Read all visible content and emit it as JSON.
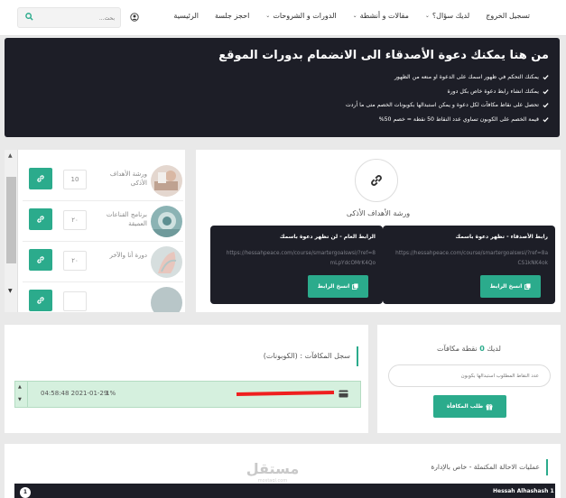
{
  "nav": {
    "search_placeholder": "بحث...",
    "items": [
      {
        "label": "الرئيسية",
        "caret": false
      },
      {
        "label": "احجز جلسة",
        "caret": false
      },
      {
        "label": "الدورات و الشروحات",
        "caret": true
      },
      {
        "label": "مقالات و أنشطة",
        "caret": true
      },
      {
        "label": "لديك سؤال؟",
        "caret": true
      },
      {
        "label": "تسجيل الخروج",
        "caret": false
      }
    ]
  },
  "hero": {
    "title": "من هنا يمكنك دعوة الأصدقاء الى الانضمام بدورات الموقع",
    "bullets": [
      "يمكنك التحكم في ظهور اسمك على الدعوة او منعه من الظهور",
      "يمكنك انشاء رابط دعوة خاص بكل دورة",
      "تحصل على نقاط مكافآت لكل دعوة و يمكن استبدالها بكوبونات الخصم متى ما أردت",
      "قيمة الخصم على الكوبون تساوي عدد النقاط 50 نقطة = خصم 50%"
    ]
  },
  "courses": [
    {
      "title": "ورشة الأهداف الأذكى",
      "points": "10"
    },
    {
      "title": "برنامج القناعات العميقة",
      "points": "٢٠"
    },
    {
      "title": "دورة أنا والآخر",
      "points": "٢٠"
    },
    {
      "title": "",
      "points": ""
    }
  ],
  "invite": {
    "course_title": "ورشة الأهداف الأذكى",
    "cards": [
      {
        "title": "رابط الأصدقاء - تظهر دعوة باسمك",
        "url": "https://hessahpeace.com/course/smartergoalswsi/?ref=8aCS1kNK4ok",
        "button": "انسخ الرابط"
      },
      {
        "title": "الرابط العام - لن تظهر دعوة باسمك",
        "url": "https://hessahpeace.com/course/smartergoalswsi/?ref=8mLpYdcOMrK4Qo",
        "button": "انسخ الرابط"
      }
    ]
  },
  "rewards_log": {
    "title": "سجل المكافآت : (الكوبونات)",
    "entries": [
      {
        "date": "04:58:48 2021-01-29",
        "percent": "1%"
      }
    ]
  },
  "claim": {
    "prefix": "لديك",
    "points_value": "0",
    "suffix": "نقطة مكافآت",
    "input_placeholder": "عدد النقاط المطلوب استبدالها بكوبون",
    "button": "طلب المكافأة"
  },
  "completed": {
    "title": "عمليات الاحالة المكتملة - خاص بالإدارة",
    "row_badge": "1",
    "row_name": "Hessah Alhashash 1"
  },
  "watermark": {
    "text": "مستقل",
    "sub": "mostaql.com"
  },
  "colors": {
    "accent": "#2bab8c",
    "dark": "#1d1e27",
    "redact": "#ef1f1f"
  }
}
